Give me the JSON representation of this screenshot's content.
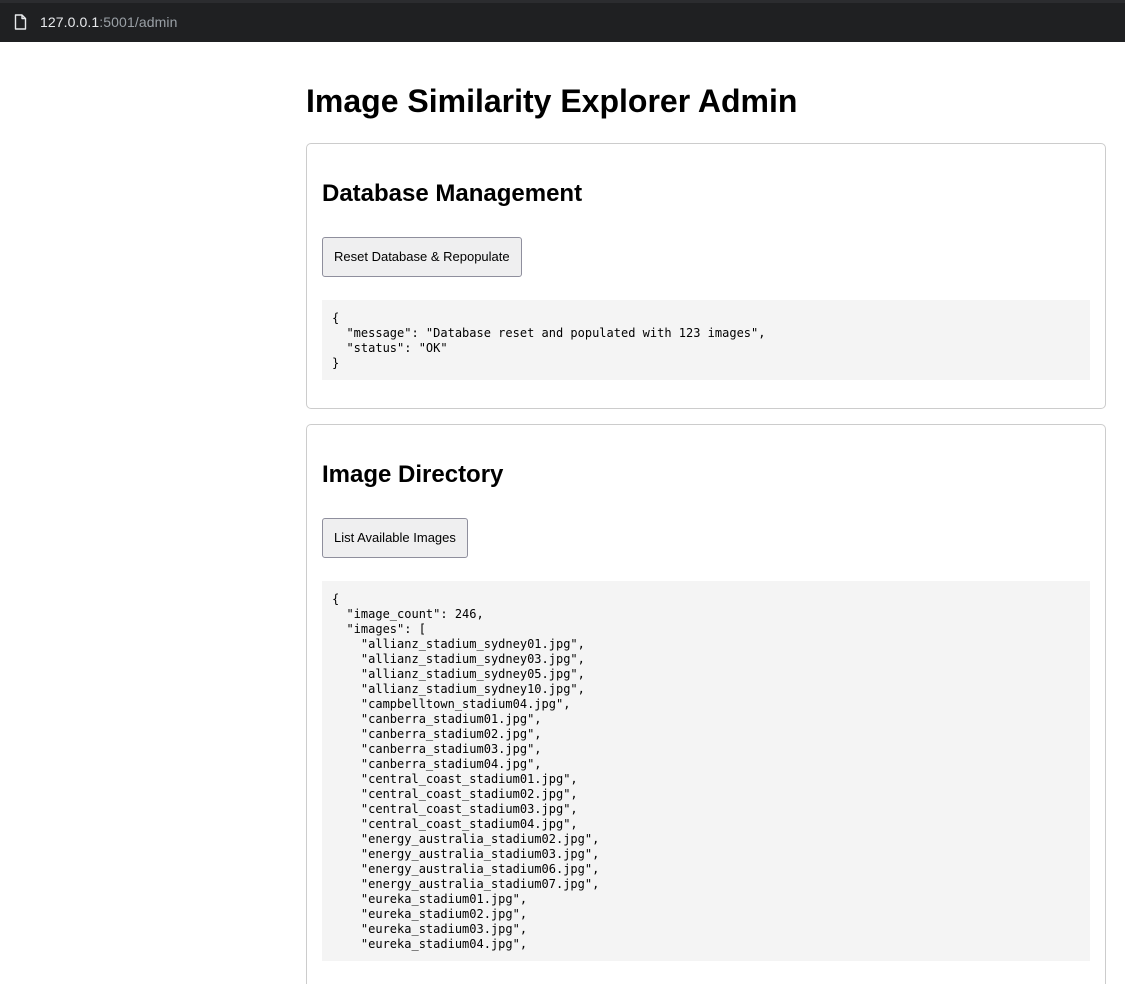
{
  "browser": {
    "url_host": "127.0.0.1",
    "url_rest": ":5001/admin"
  },
  "page": {
    "title": "Image Similarity Explorer Admin"
  },
  "database_section": {
    "heading": "Database Management",
    "button_label": "Reset Database & Repopulate",
    "response": "{\n  \"message\": \"Database reset and populated with 123 images\",\n  \"status\": \"OK\"\n}"
  },
  "image_section": {
    "heading": "Image Directory",
    "button_label": "List Available Images",
    "response": "{\n  \"image_count\": 246,\n  \"images\": [\n    \"allianz_stadium_sydney01.jpg\",\n    \"allianz_stadium_sydney03.jpg\",\n    \"allianz_stadium_sydney05.jpg\",\n    \"allianz_stadium_sydney10.jpg\",\n    \"campbelltown_stadium04.jpg\",\n    \"canberra_stadium01.jpg\",\n    \"canberra_stadium02.jpg\",\n    \"canberra_stadium03.jpg\",\n    \"canberra_stadium04.jpg\",\n    \"central_coast_stadium01.jpg\",\n    \"central_coast_stadium02.jpg\",\n    \"central_coast_stadium03.jpg\",\n    \"central_coast_stadium04.jpg\",\n    \"energy_australia_stadium02.jpg\",\n    \"energy_australia_stadium03.jpg\",\n    \"energy_australia_stadium06.jpg\",\n    \"energy_australia_stadium07.jpg\",\n    \"eureka_stadium01.jpg\",\n    \"eureka_stadium02.jpg\",\n    \"eureka_stadium03.jpg\",\n    \"eureka_stadium04.jpg\","
  }
}
